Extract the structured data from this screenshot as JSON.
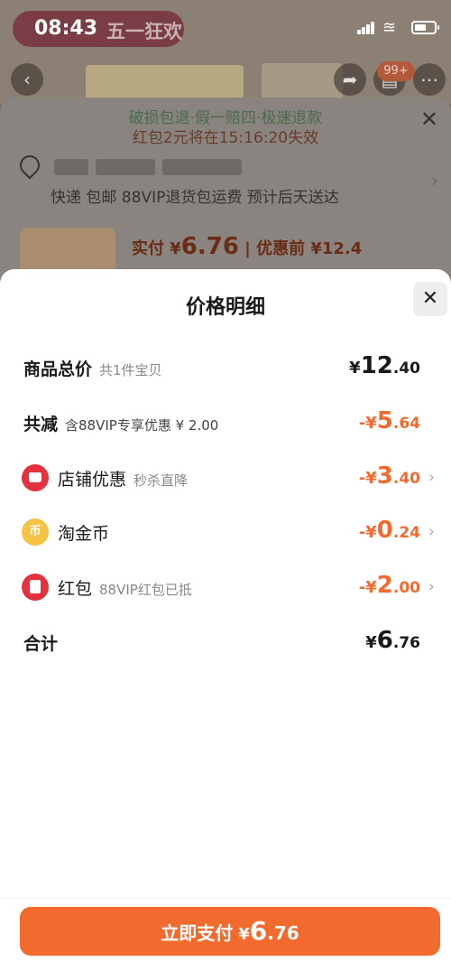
{
  "status_bar": {
    "time": "08:43",
    "promo": "五一狂欢"
  },
  "bg": {
    "cart_badge": "99+",
    "guarantee": "破损包退·假一赔四·极速退款",
    "countdown": "红包2元将在15:16:20失效",
    "shipping": "快递 包邮 88VIP退货包运费 预计后天送达",
    "price_label": "实付 ¥",
    "price_value": "6.76",
    "price_before": "| 优惠前 ¥12.4"
  },
  "modal": {
    "title": "价格明细",
    "rows": [
      {
        "label": "商品总价",
        "sub": "共1件宝贝",
        "cur": "¥",
        "int": "12",
        "dec": ".40"
      },
      {
        "label": "共减",
        "sub": "含88VIP专享优惠 ¥ 2.00",
        "cur": "-¥",
        "int": "5",
        "dec": ".64"
      },
      {
        "label": "店铺优惠",
        "sub": "秒杀直降",
        "cur": "-¥",
        "int": "3",
        "dec": ".40"
      },
      {
        "label": "淘金币",
        "sub": "",
        "cur": "-¥",
        "int": "0",
        "dec": ".24"
      },
      {
        "label": "红包",
        "sub": "88VIP红包已抵",
        "cur": "-¥",
        "int": "2",
        "dec": ".00"
      },
      {
        "label": "合计",
        "sub": "",
        "cur": "¥",
        "int": "6",
        "dec": ".76"
      }
    ]
  },
  "pay_button": {
    "label": "立即支付",
    "cur": "¥",
    "int": "6",
    "dec": ".76"
  },
  "colors": {
    "accent": "#f26a2e",
    "red": "#e3323e",
    "gold": "#f5c343"
  }
}
